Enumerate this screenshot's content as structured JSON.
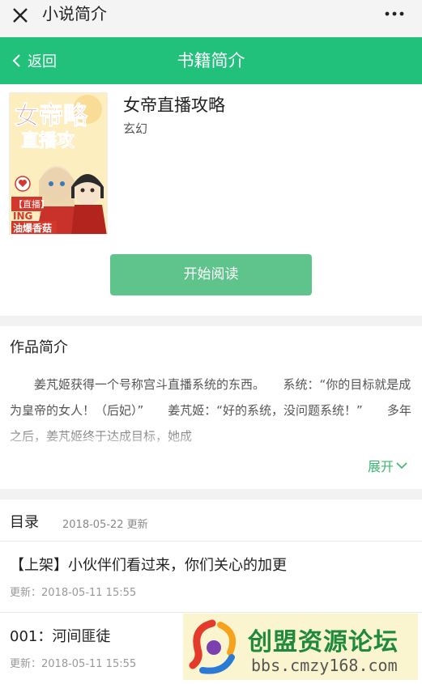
{
  "wechat": {
    "title": "小说简介"
  },
  "header": {
    "back_label": "返回",
    "title": "书籍简介"
  },
  "book": {
    "title": "女帝直播攻略",
    "genre": "玄幻",
    "cover_texts": [
      "女帝略",
      "直播攻",
      "【直播】",
      "ING",
      "油爆香菇"
    ],
    "read_button": "开始阅读"
  },
  "intro": {
    "heading": "作品简介",
    "text": "姜芃姬获得一个号称宫斗直播系统的东西。　　系统：“你的目标就是成为皇帝的女人！（后妃）”　　姜芃姬：“好的系统，没问题系统！”　　多年之后，姜芃姬终于达成目标，她成",
    "expand_label": "展开"
  },
  "catalog": {
    "title": "目录",
    "updated": "2018-05-22 更新",
    "chapters": [
      {
        "title": "【上架】小伙伴们看过来，你们关心的加更",
        "update": "更新：2018-05-11 15:55"
      },
      {
        "title": "001：河间匪徒",
        "update": "更新：2018-05-11 15:55"
      }
    ]
  },
  "watermark": {
    "name": "创盟资源论坛",
    "url": "bbs.cmzy168.com"
  },
  "colors": {
    "header_green": "#21c17c",
    "button_green": "#5fc48b",
    "link_green": "#3ab870"
  }
}
